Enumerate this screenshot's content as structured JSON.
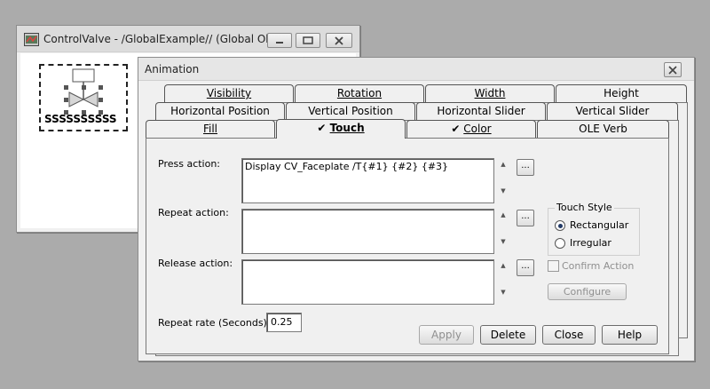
{
  "bg_window": {
    "title": "ControlValve - /GlobalExample// (Global Obj...",
    "symbol_label": "SSSSSSSSSS"
  },
  "dialog": {
    "title": "Animation",
    "tabs_row1": [
      "Visibility",
      "Rotation",
      "Width",
      "Height"
    ],
    "tabs_row2": [
      "Horizontal Position",
      "Vertical Position",
      "Horizontal Slider",
      "Vertical Slider"
    ],
    "tabs_row3": [
      "Fill",
      "Touch",
      "Color",
      "OLE Verb"
    ],
    "checked_tabs": [
      "Touch",
      "Color"
    ],
    "active_tab": "Touch",
    "press_label": "Press action:",
    "press_value": "Display CV_Faceplate /T{#1} {#2} {#3}",
    "repeat_label": "Repeat action:",
    "repeat_value": "",
    "release_label": "Release action:",
    "release_value": "",
    "dots_label": "...",
    "touch_style": {
      "title": "Touch Style",
      "options": [
        "Rectangular",
        "Irregular"
      ],
      "selected": "Rectangular"
    },
    "confirm_action_label": "Confirm Action",
    "configure_label": "Configure",
    "repeat_rate_label": "Repeat rate (Seconds):",
    "repeat_rate_value": "0.25",
    "buttons": {
      "apply": "Apply",
      "delete": "Delete",
      "close": "Close",
      "help": "Help"
    }
  },
  "colors": {
    "desktop": "#ababab",
    "window_face": "#f0f0f0",
    "radio_dot": "#223a66"
  }
}
